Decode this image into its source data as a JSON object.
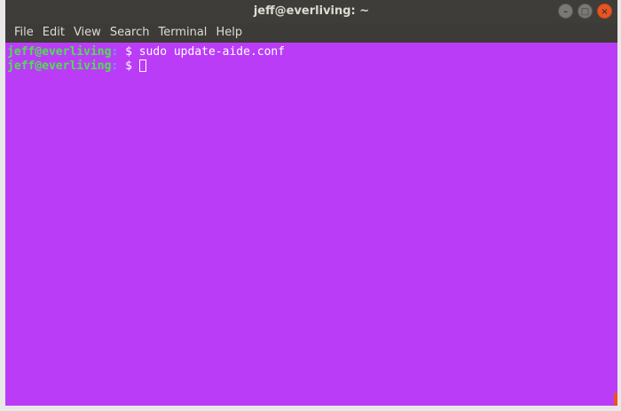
{
  "window": {
    "title": "jeff@everliving: ~"
  },
  "controls": {
    "minimize": "–",
    "maximize": "□",
    "close": "×"
  },
  "menubar": {
    "items": [
      "File",
      "Edit",
      "View",
      "Search",
      "Terminal",
      "Help"
    ]
  },
  "terminal": {
    "lines": [
      {
        "user_host": "jeff@everliving",
        "separator": ":",
        "path": " ",
        "symbol": "$ ",
        "command": "sudo update-aide.conf"
      },
      {
        "user_host": "jeff@everliving",
        "separator": ":",
        "path": " ",
        "symbol": "$ ",
        "command": ""
      }
    ]
  },
  "colors": {
    "terminal_background": "#bb3cf7",
    "prompt_user": "#4ee04e",
    "accent": "#e95420"
  }
}
